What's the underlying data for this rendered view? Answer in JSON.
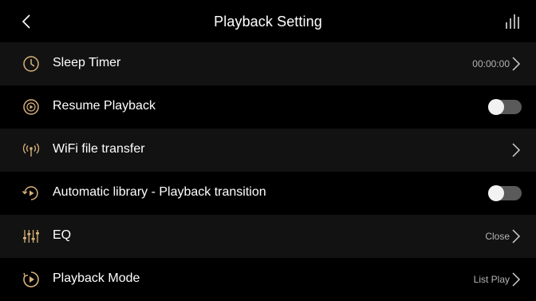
{
  "header": {
    "title": "Playback Setting",
    "back_icon": "chevron-left-icon",
    "right_icon": "equalizer-bars-icon"
  },
  "colors": {
    "accent_gold": "#d8b27a",
    "row_alt_bg": "#121212",
    "toggle_off": "#5a5a5a"
  },
  "settings": [
    {
      "label": "Sleep Timer",
      "icon": "clock-icon",
      "value": "00:00:00",
      "control": "chevron"
    },
    {
      "label": "Resume Playback",
      "icon": "resume-playback-icon",
      "control": "toggle",
      "on": false
    },
    {
      "label": "WiFi file transfer",
      "icon": "wifi-transfer-icon",
      "control": "chevron"
    },
    {
      "label": "Automatic library - Playback transition",
      "icon": "playback-transition-icon",
      "control": "toggle",
      "on": false
    },
    {
      "label": "EQ",
      "icon": "eq-sliders-icon",
      "value": "Close",
      "control": "chevron"
    },
    {
      "label": "Playback Mode",
      "icon": "playback-mode-icon",
      "value": "List Play",
      "control": "chevron"
    }
  ]
}
